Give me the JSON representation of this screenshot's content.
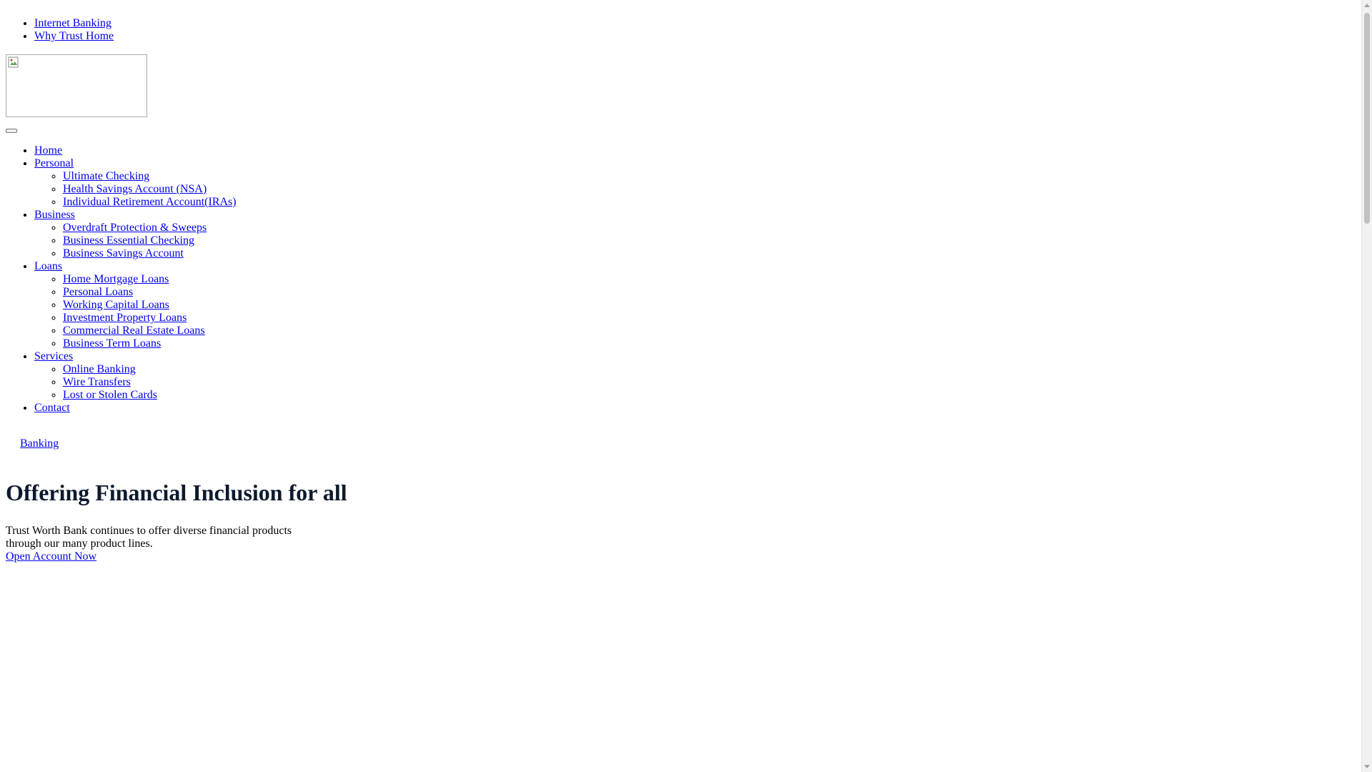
{
  "top_links": [
    {
      "label": "Internet Banking"
    },
    {
      "label": "Why Trust Home"
    }
  ],
  "nav": {
    "home": "Home",
    "personal": {
      "label": "Personal",
      "items": [
        "Ultimate Checking",
        "Health Savings Account (NSA)",
        "Individual Retirement Account(IRAs)"
      ]
    },
    "business": {
      "label": "Business",
      "items": [
        "Overdraft Protection & Sweeps",
        "Business Essential Checking",
        "Business Savings Account"
      ]
    },
    "loans": {
      "label": "Loans",
      "items": [
        "Home Mortgage Loans",
        "Personal Loans",
        "Working Capital Loans",
        "Investment Property Loans",
        "Commercial Real Estate Loans",
        "Business Term Loans"
      ]
    },
    "services": {
      "label": "Services",
      "items": [
        "Online Banking",
        "Wire Transfers",
        "Lost or Stolen Cards"
      ]
    },
    "contact": "Contact"
  },
  "banking_link": "Banking",
  "hero": {
    "title": "Offering Financial Inclusion for all",
    "text_line1": "Trust Worth Bank continues to offer diverse financial products",
    "text_line2": "through our many product lines.",
    "cta": "Open Account Now"
  },
  "icons": {
    "logo": "broken-image-icon",
    "toggler": "menu-toggle-icon"
  }
}
